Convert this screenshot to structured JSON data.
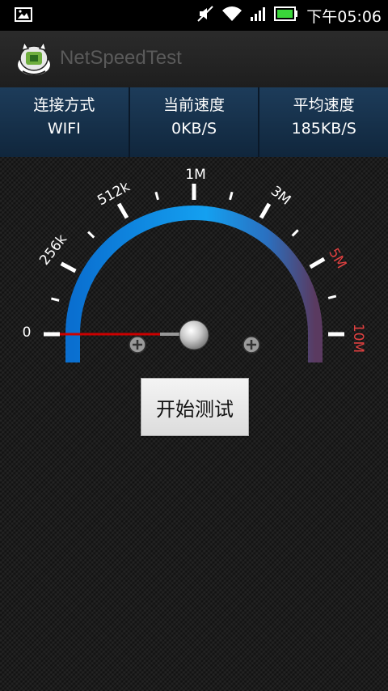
{
  "status_bar": {
    "time": "下午05:06",
    "icons": [
      "image-icon",
      "mute-icon",
      "wifi-icon",
      "signal-icon",
      "battery-icon"
    ]
  },
  "app": {
    "title": "NetSpeedTest"
  },
  "info": {
    "connection_label": "连接方式",
    "connection_value": "WIFI",
    "current_label": "当前速度",
    "current_value": "0KB/S",
    "average_label": "平均速度",
    "average_value": "185KB/S"
  },
  "gauge": {
    "labels": [
      "0",
      "256k",
      "512k",
      "1M",
      "3M",
      "5M",
      "10M"
    ],
    "needle_value": "0",
    "colors": {
      "arc_start": "#0a7fe0",
      "arc_end": "#5a3a60",
      "needle": "#d00000",
      "warn_label": "#e04040"
    }
  },
  "controls": {
    "start_label": "开始测试"
  }
}
